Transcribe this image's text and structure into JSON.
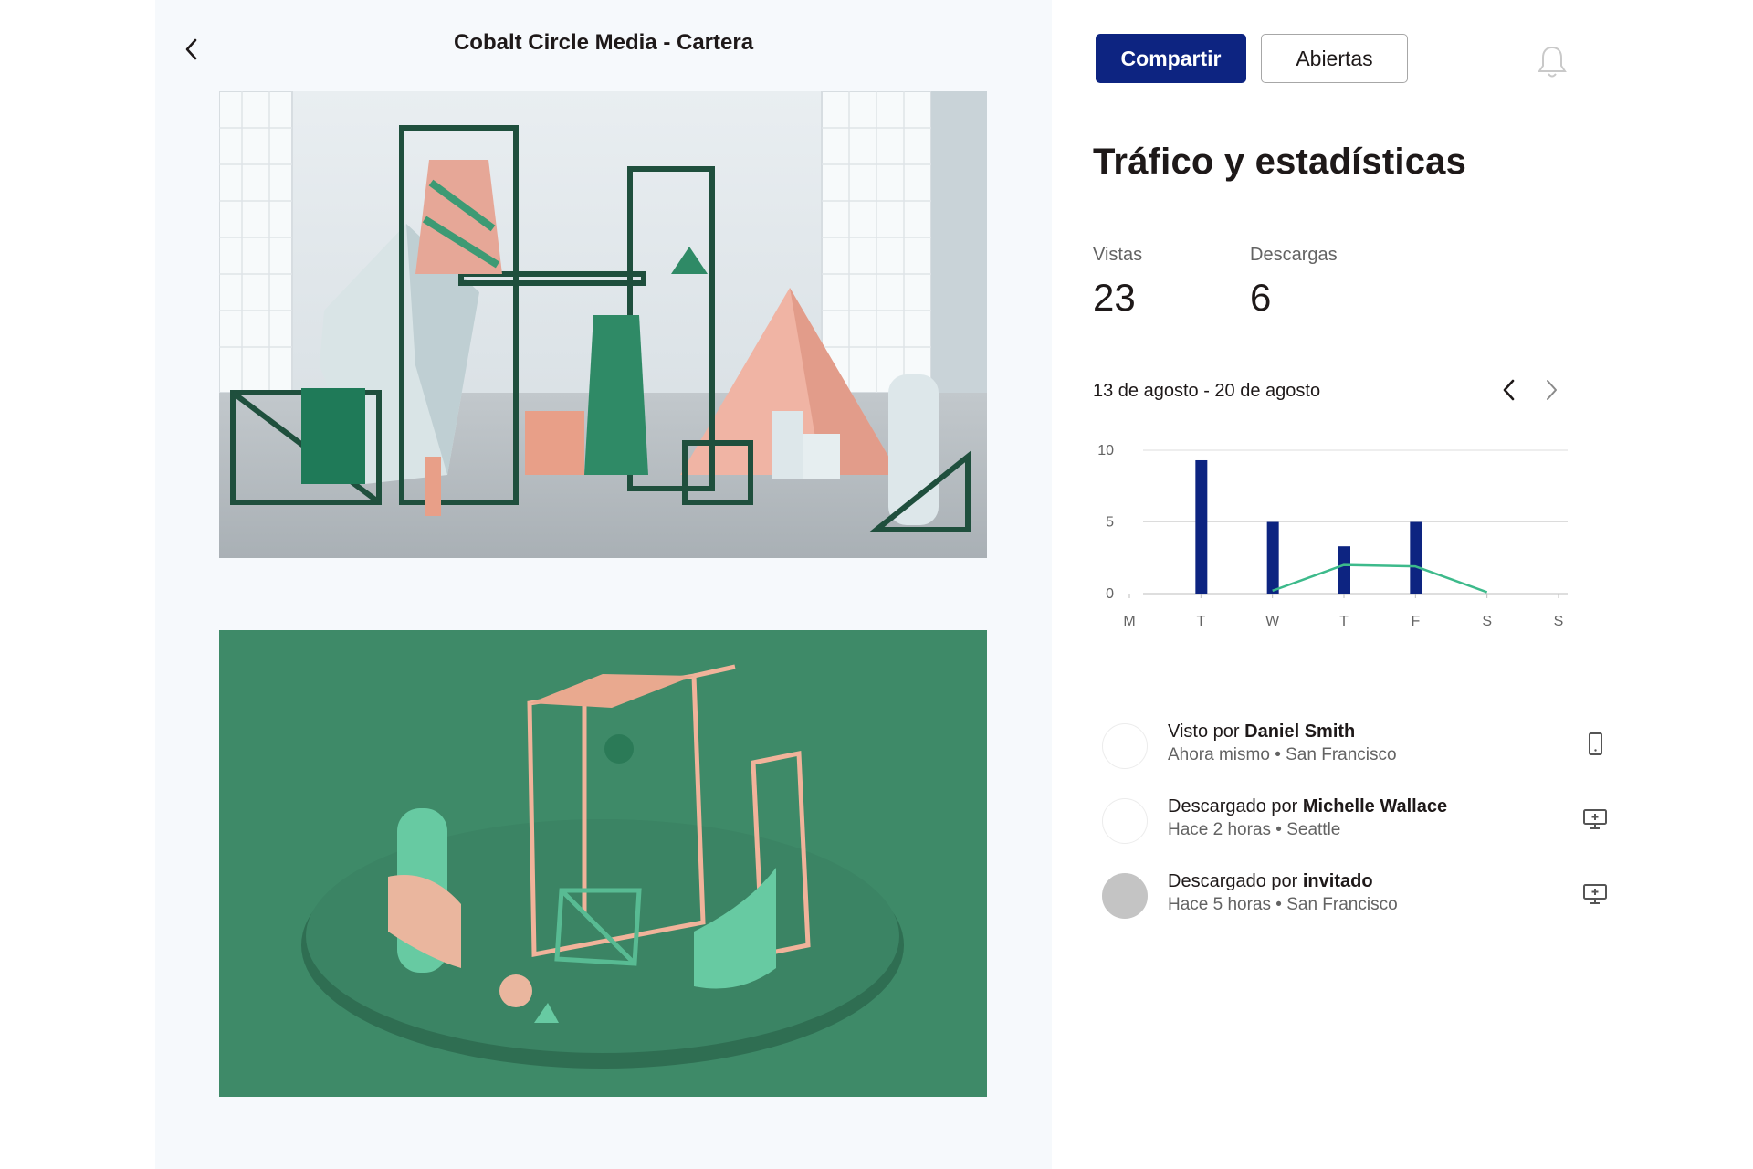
{
  "header": {
    "title": "Cobalt Circle Media - Cartera"
  },
  "toolbar": {
    "share_label": "Compartir",
    "open_label": "Abiertas"
  },
  "stats": {
    "title": "Tráfico y estadísticas",
    "views_label": "Vistas",
    "views_value": "23",
    "downloads_label": "Descargas",
    "downloads_value": "6",
    "date_range": "13 de agosto - 20 de agosto"
  },
  "chart_data": {
    "type": "bar",
    "categories": [
      "M",
      "T",
      "W",
      "T",
      "F",
      "S",
      "S"
    ],
    "series": [
      {
        "type": "bar",
        "values": [
          0,
          9.3,
          5,
          3.3,
          5,
          0,
          0
        ],
        "color": "#0d2481"
      },
      {
        "type": "line",
        "values": [
          null,
          null,
          0.2,
          2,
          1.9,
          0.1,
          null
        ],
        "color": "#3dba8b"
      }
    ],
    "yticks": [
      0,
      5,
      10
    ],
    "ylim": [
      0,
      10
    ],
    "grid": true
  },
  "activity": [
    {
      "action": "Visto por",
      "name": "Daniel Smith",
      "detail": "Ahora mismo • San Francisco",
      "device": "mobile-icon",
      "avatar": "empty"
    },
    {
      "action": "Descargado por",
      "name": "Michelle Wallace",
      "detail": "Hace 2 horas • Seattle",
      "device": "desktop-icon",
      "avatar": "empty"
    },
    {
      "action": "Descargado por",
      "name": "invitado",
      "detail": "Hace 5 horas • San Francisco",
      "device": "desktop-icon",
      "avatar": "gray"
    }
  ],
  "icons": {
    "back": "chevron-left-icon",
    "notifications": "bell-icon",
    "prev": "chevron-left-icon",
    "next": "chevron-right-icon"
  },
  "colors": {
    "primary": "#0d2481",
    "line": "#3dba8b",
    "panel_bg": "#f6f9fc"
  }
}
